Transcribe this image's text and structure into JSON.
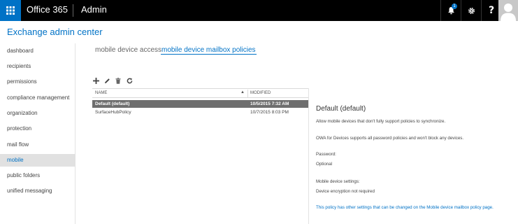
{
  "topbar": {
    "brand": "Office 365",
    "app": "Admin",
    "notification_count": "1",
    "help_label": "?"
  },
  "header": {
    "title": "Exchange admin center"
  },
  "nav": {
    "items": [
      "dashboard",
      "recipients",
      "permissions",
      "compliance management",
      "organization",
      "protection",
      "mail flow",
      "mobile",
      "public folders",
      "unified messaging"
    ],
    "selected": "mobile"
  },
  "tabs": {
    "t1": "mobile device access",
    "t2": "mobile device mailbox policies"
  },
  "toolbar": {
    "icons": [
      "plus-icon",
      "pencil-icon",
      "trash-icon",
      "refresh-icon"
    ]
  },
  "list": {
    "col_name": "NAME",
    "col_sort": "▲",
    "col_modified": "MODIFIED",
    "rows": [
      {
        "name": "Default (default)",
        "modified": "10/5/2015 7:32 AM"
      },
      {
        "name": "SurfaceHubPolicy",
        "modified": "10/7/2015 8:03 PM"
      }
    ]
  },
  "detail": {
    "title": "Default (default)",
    "line1": "Allow mobile devices that don't fully support policies to synchronize.",
    "line2": "OWA for Devices supports all password policies and won't block any devices.",
    "pw_label": "Password:",
    "pw_value": "Optional",
    "mds_label": "Mobile device settings:",
    "mds_value": "Device encryption not required",
    "link": "This policy has other settings that can be changed on the Mobile device mailbox policy page."
  },
  "colors": {
    "accent": "#0072c6",
    "topbar": "#000000",
    "selected_row": "#6e6e6e",
    "selected_nav": "#e1e1e1"
  }
}
